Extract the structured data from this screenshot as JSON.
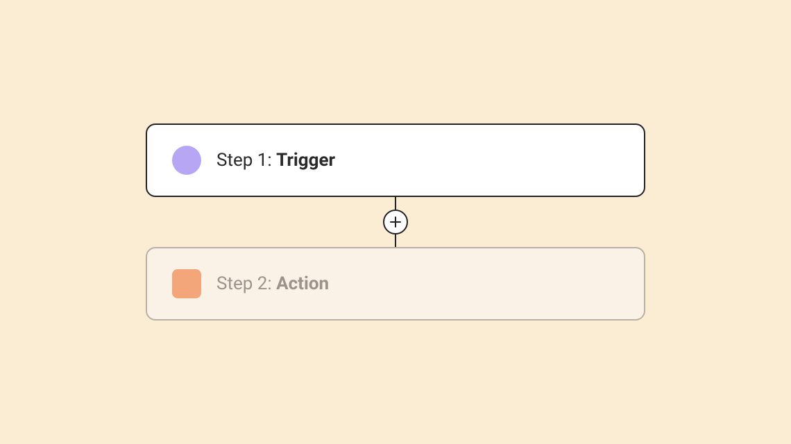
{
  "steps": [
    {
      "prefix": "Step 1: ",
      "name": "Trigger",
      "swatch_color": "#B6A6F3",
      "swatch_shape": "circle",
      "active": true
    },
    {
      "prefix": "Step 2: ",
      "name": "Action",
      "swatch_color": "#F2A679",
      "swatch_shape": "square",
      "active": false
    }
  ],
  "colors": {
    "background": "#fbecd4",
    "active_border": "#222222",
    "inactive_border": "#b8b0a6"
  }
}
